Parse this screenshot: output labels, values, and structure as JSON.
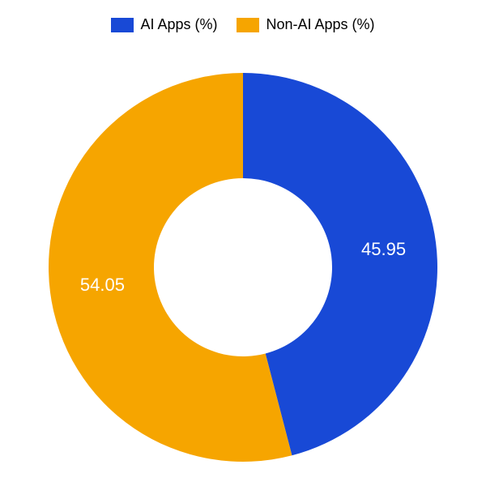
{
  "chart_data": {
    "type": "pie",
    "series": [
      {
        "name": "AI Apps (%)",
        "value": 45.95,
        "color": "#1849d6"
      },
      {
        "name": "Non-AI Apps (%)",
        "value": 54.05,
        "color": "#f6a500"
      }
    ],
    "donut": true,
    "legend_position": "top"
  }
}
